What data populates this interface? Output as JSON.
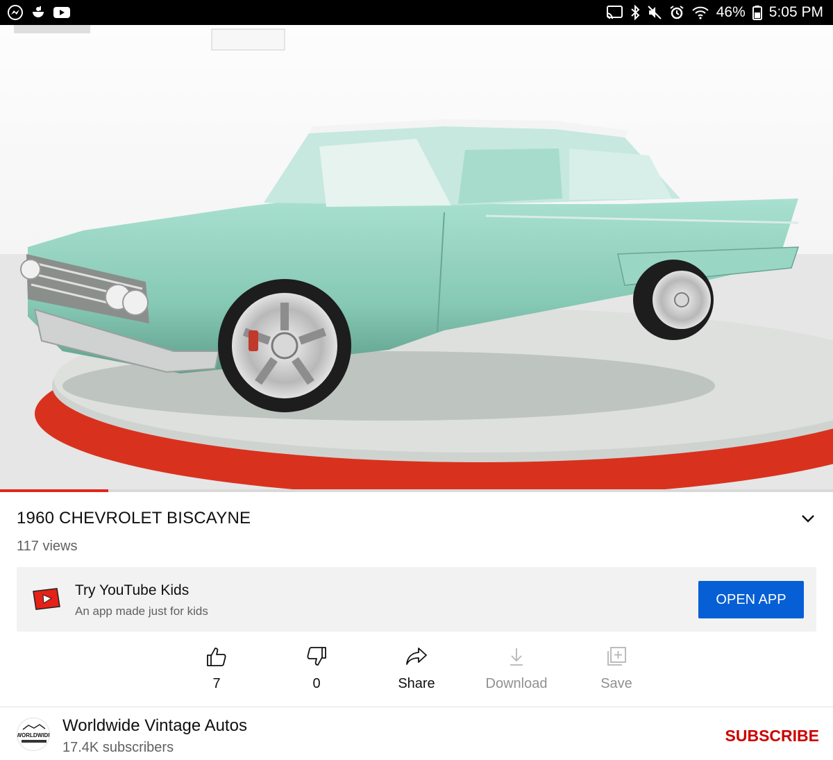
{
  "status_bar": {
    "battery": "46%",
    "time": "5:05 PM",
    "left_icons": [
      "messenger-icon",
      "app-icon",
      "youtube-icon"
    ],
    "right_icons": [
      "cast-icon",
      "bluetooth-icon",
      "mute-icon",
      "alarm-icon",
      "wifi-icon",
      "battery-icon"
    ]
  },
  "video": {
    "progress_fraction": 0.13
  },
  "title": "1960 CHEVROLET BISCAYNE",
  "views": "117 views",
  "promo": {
    "title": "Try YouTube Kids",
    "subtitle": "An app made just for kids",
    "button": "OPEN APP",
    "icon": "youtube-kids-icon"
  },
  "actions": [
    {
      "label": "7",
      "icon": "like-icon"
    },
    {
      "label": "0",
      "icon": "dislike-icon"
    },
    {
      "label": "Share",
      "icon": "share-icon"
    },
    {
      "label": "Download",
      "icon": "download-icon"
    },
    {
      "label": "Save",
      "icon": "save-playlist-icon"
    }
  ],
  "channel": {
    "name": "Worldwide Vintage Autos",
    "subscribers": "17.4K subscribers",
    "avatar_text": "WORLDWIDE",
    "subscribe_label": "SUBSCRIBE"
  },
  "colors": {
    "accent_red": "#cc0000",
    "progress_red": "#e1261c",
    "open_app_blue": "#065fd4",
    "car_teal": "#8fd3c0"
  }
}
